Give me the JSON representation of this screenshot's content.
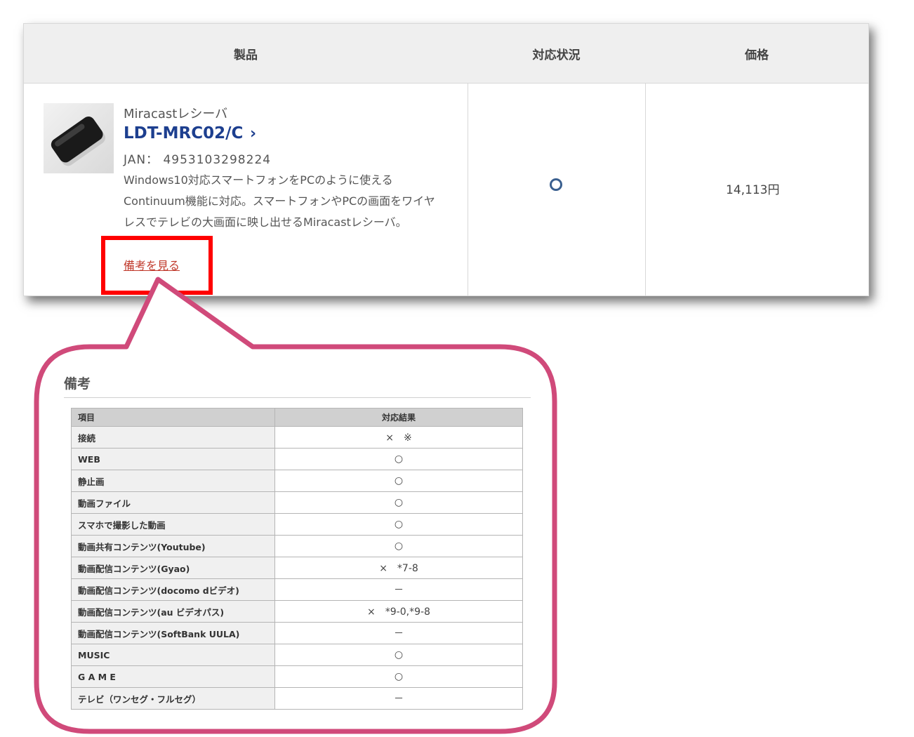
{
  "product_table": {
    "headers": {
      "product": "製品",
      "status": "対応状況",
      "price": "価格"
    },
    "product": {
      "category": "Miracastレシーバ",
      "model": "LDT-MRC02/C",
      "model_chevron": "›",
      "jan": "JAN： 4953103298224",
      "description": "Windows10対応スマートフォンをPCのように使えるContinuum機能に対応。スマートフォンやPCの画面をワイヤレスでテレビの大画面に映し出せるMiracastレシーバ。",
      "remarks_link": "備考を見る",
      "image_icon": "wireless-receiver-device-icon"
    },
    "status_icon": "circle-mark-icon",
    "price": "14,113円"
  },
  "remarks": {
    "title": "備考",
    "headers": {
      "item": "項目",
      "result": "対応結果"
    },
    "rows": [
      {
        "item": "接続",
        "result": "×　※"
      },
      {
        "item": "WEB",
        "result": "○"
      },
      {
        "item": "静止画",
        "result": "○"
      },
      {
        "item": "動画ファイル",
        "result": "○"
      },
      {
        "item": "スマホで撮影した動画",
        "result": "○"
      },
      {
        "item": "動画共有コンテンツ(Youtube)",
        "result": "○"
      },
      {
        "item": "動画配信コンテンツ(Gyao)",
        "result": "×　*7-8"
      },
      {
        "item": "動画配信コンテンツ(docomo dビデオ)",
        "result": "－"
      },
      {
        "item": "動画配信コンテンツ(au ビデオパス)",
        "result": "×　*9-0,*9-8"
      },
      {
        "item": "動画配信コンテンツ(SoftBank UULA)",
        "result": "－"
      },
      {
        "item": "MUSIC",
        "result": "○"
      },
      {
        "item": "G A M E",
        "result": "○"
      },
      {
        "item": "テレビ（ワンセグ・フルセグ）",
        "result": "－"
      }
    ]
  },
  "colors": {
    "highlight": "#ff0000",
    "callout_border": "#d04a7a",
    "link": "#1d3f8f",
    "remarks_link": "#c0392b"
  }
}
